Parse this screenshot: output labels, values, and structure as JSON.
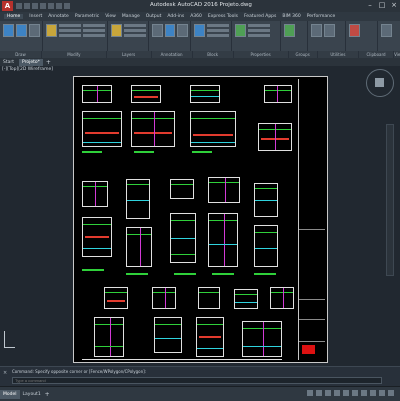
{
  "app": {
    "logo": "A",
    "title": "Autodesk AutoCAD 2016   Projeto.dwg"
  },
  "window_controls": {
    "minimize": "–",
    "maximize": "□",
    "close": "×"
  },
  "ribbon_tabs": [
    "Home",
    "Insert",
    "Annotate",
    "Parametric",
    "View",
    "Manage",
    "Output",
    "Add-ins",
    "A360",
    "Express Tools",
    "Featured Apps",
    "BIM 360",
    "Performance"
  ],
  "active_ribbon_tab": "Home",
  "ribbon_panels": [
    "Draw",
    "Modify",
    "Layers",
    "Annotation",
    "Block",
    "Properties",
    "Groups",
    "Utilities",
    "Clipboard",
    "View"
  ],
  "file_tabs": [
    "Start",
    "Projeto*"
  ],
  "active_file_tab": "Projeto*",
  "viewport_label": "[-][Top][2D Wireframe]",
  "command": {
    "history": "Command:  Specify opposite corner or [Fence/WPolygon/CPolygon]:",
    "placeholder": "Type a command"
  },
  "layout_tabs": [
    "Model",
    "Layout1"
  ],
  "active_layout_tab": "Model",
  "colors": {
    "background": "#212830",
    "sheet": "#000000",
    "green": "#2fd03a",
    "red": "#e23b2e",
    "magenta": "#d23ad6",
    "cyan": "#2fd3de",
    "white": "#e0e0e0"
  }
}
